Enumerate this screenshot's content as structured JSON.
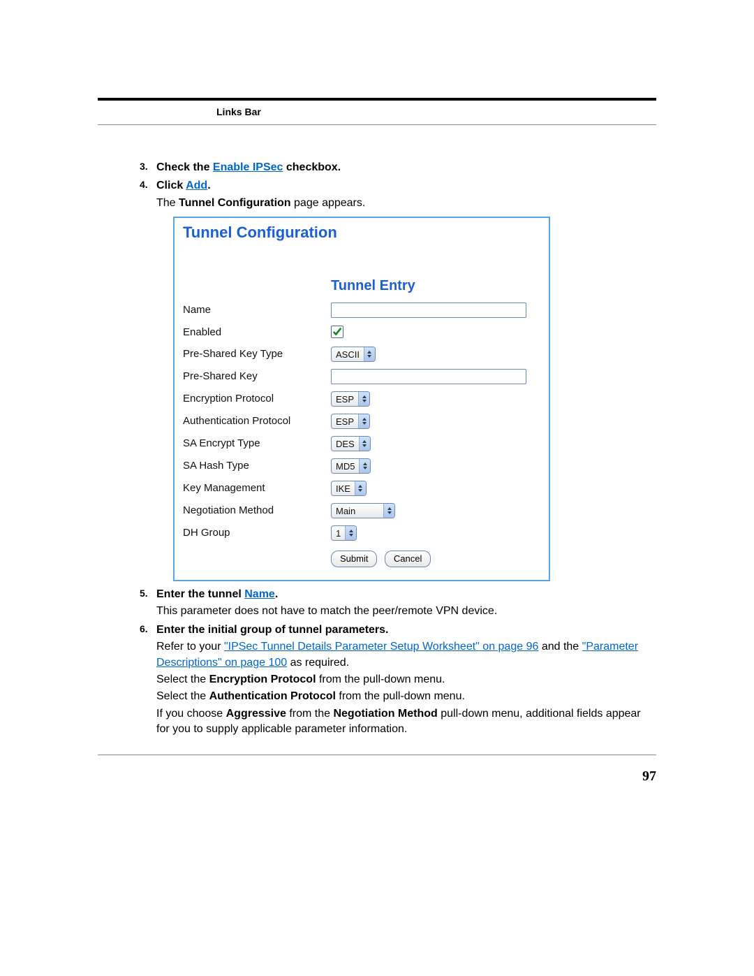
{
  "header": {
    "label": "Links Bar"
  },
  "steps": {
    "s3": {
      "num": "3.",
      "prefix": "Check the ",
      "link": "Enable IPSec",
      "suffix": " checkbox."
    },
    "s4": {
      "num": "4.",
      "prefix": "Click ",
      "link": "Add",
      "suffix": ".",
      "sub_a": "The ",
      "sub_b": "Tunnel Configuration",
      "sub_c": " page appears."
    },
    "s5": {
      "num": "5.",
      "prefix": "Enter the tunnel ",
      "link": "Name",
      "suffix": ".",
      "sub": "This parameter does not have to match the peer/remote VPN device."
    },
    "s6": {
      "num": "6.",
      "title": "Enter the initial group of tunnel parameters.",
      "l1a": "Refer to your ",
      "l1link1": "\"IPSec Tunnel Details Parameter Setup Worksheet\" on page 96",
      "l1b": " and the ",
      "l1link2": "\"Parameter Descriptions\" on page 100",
      "l1c": " as required.",
      "l2a": "Select the ",
      "l2b": "Encryption Protocol",
      "l2c": " from the pull-down menu.",
      "l3a": "Select the ",
      "l3b": "Authentication Protocol",
      "l3c": " from the pull-down menu.",
      "l4a": "If you choose ",
      "l4b": "Aggressive",
      "l4c": " from the ",
      "l4d": "Negotiation Method",
      "l4e": " pull-down menu, additional fields appear for you to supply applicable parameter information."
    }
  },
  "figure": {
    "title": "Tunnel Configuration",
    "section": "Tunnel Entry",
    "rows": {
      "name": "Name",
      "enabled": "Enabled",
      "psk_type": "Pre-Shared Key Type",
      "psk": "Pre-Shared Key",
      "enc_proto": "Encryption Protocol",
      "auth_proto": "Authentication Protocol",
      "sa_enc": "SA Encrypt Type",
      "sa_hash": "SA Hash Type",
      "key_mgmt": "Key Management",
      "neg_method": "Negotiation Method",
      "dh_group": "DH Group"
    },
    "values": {
      "psk_type": "ASCII",
      "enc_proto": "ESP",
      "auth_proto": "ESP",
      "sa_enc": "DES",
      "sa_hash": "MD5",
      "key_mgmt": "IKE",
      "neg_method": "Main",
      "dh_group": "1"
    },
    "buttons": {
      "submit": "Submit",
      "cancel": "Cancel"
    }
  },
  "page_number": "97"
}
